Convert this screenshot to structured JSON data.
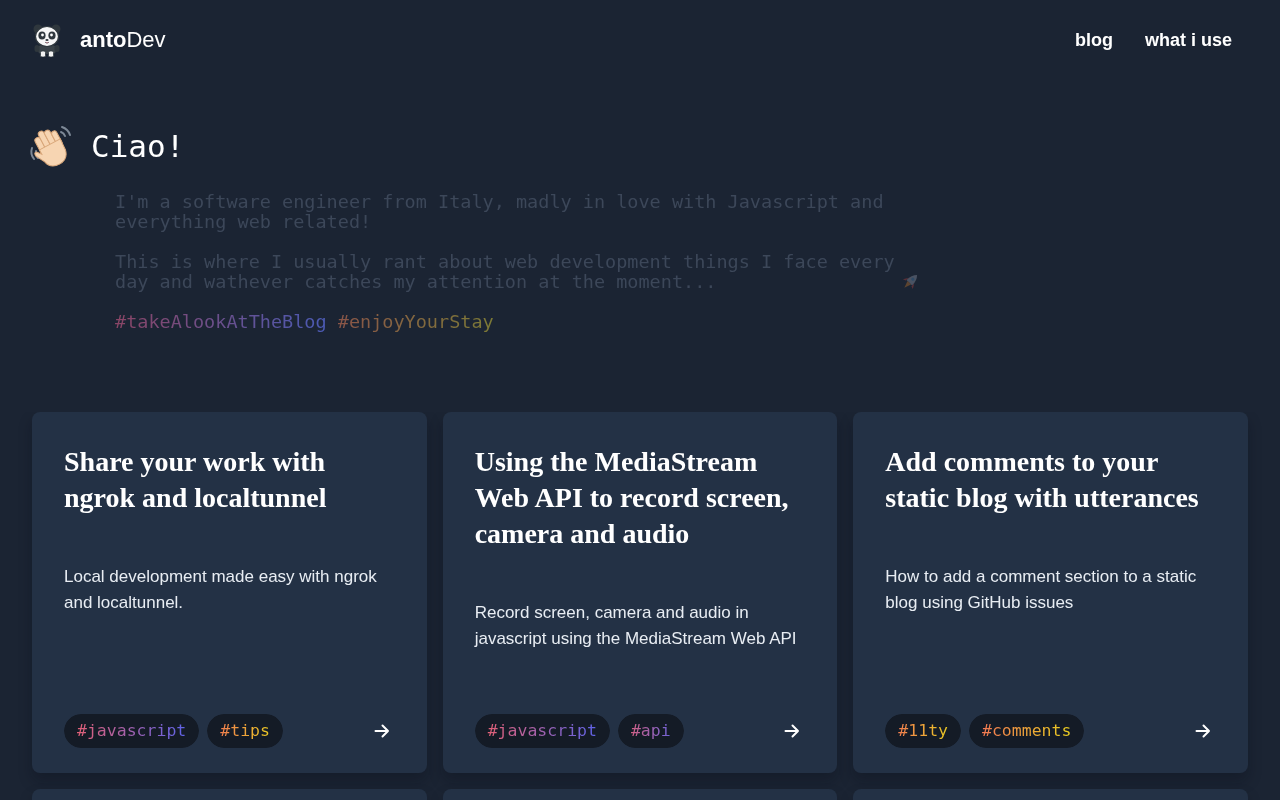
{
  "header": {
    "logo_text": "**anto**Dev",
    "nav": [
      {
        "label": "blog"
      },
      {
        "label": "what i use"
      }
    ]
  },
  "intro": {
    "heading": "Ciao!",
    "paragraphs": [
      {
        "kind": "plain",
        "text": "I'm a software engineer from Italy, madly in love with Javascript and everything web related!"
      },
      {
        "kind": "rocket",
        "text": "This is where I usually rant about web development things I face every day and wathever catches my attention at the moment..."
      }
    ],
    "hashtags": [
      {
        "text": "#takeAlookAtTheBlog",
        "kind": "cool"
      },
      {
        "text": "#enjoyYourStay",
        "kind": "warm"
      }
    ]
  },
  "posts": [
    {
      "kind": "post",
      "title": "Share your work with ngrok and localtunnel",
      "description": "Local development made easy with ngrok and localtunnel.",
      "tags": [
        {
          "text": "#javascript",
          "kind": "cool"
        },
        {
          "text": "#tips",
          "kind": "warm"
        }
      ]
    },
    {
      "kind": "post",
      "title": "Using the MediaStream Web API to record screen, camera and audio",
      "description": "Record screen, camera and audio in javascript using the MediaStream Web API",
      "tags": [
        {
          "text": "#javascript",
          "kind": "cool"
        },
        {
          "text": "#api",
          "kind": "cool"
        }
      ]
    },
    {
      "kind": "post",
      "title": "Add comments to your static blog with utterances",
      "description": "How to add a comment section to a static blog using GitHub issues",
      "tags": [
        {
          "text": "#11ty",
          "kind": "warm"
        },
        {
          "text": "#comments",
          "kind": "warm"
        }
      ]
    },
    {
      "kind": "cut-off"
    },
    {
      "kind": "cut-off"
    },
    {
      "kind": "cut-off"
    }
  ]
}
